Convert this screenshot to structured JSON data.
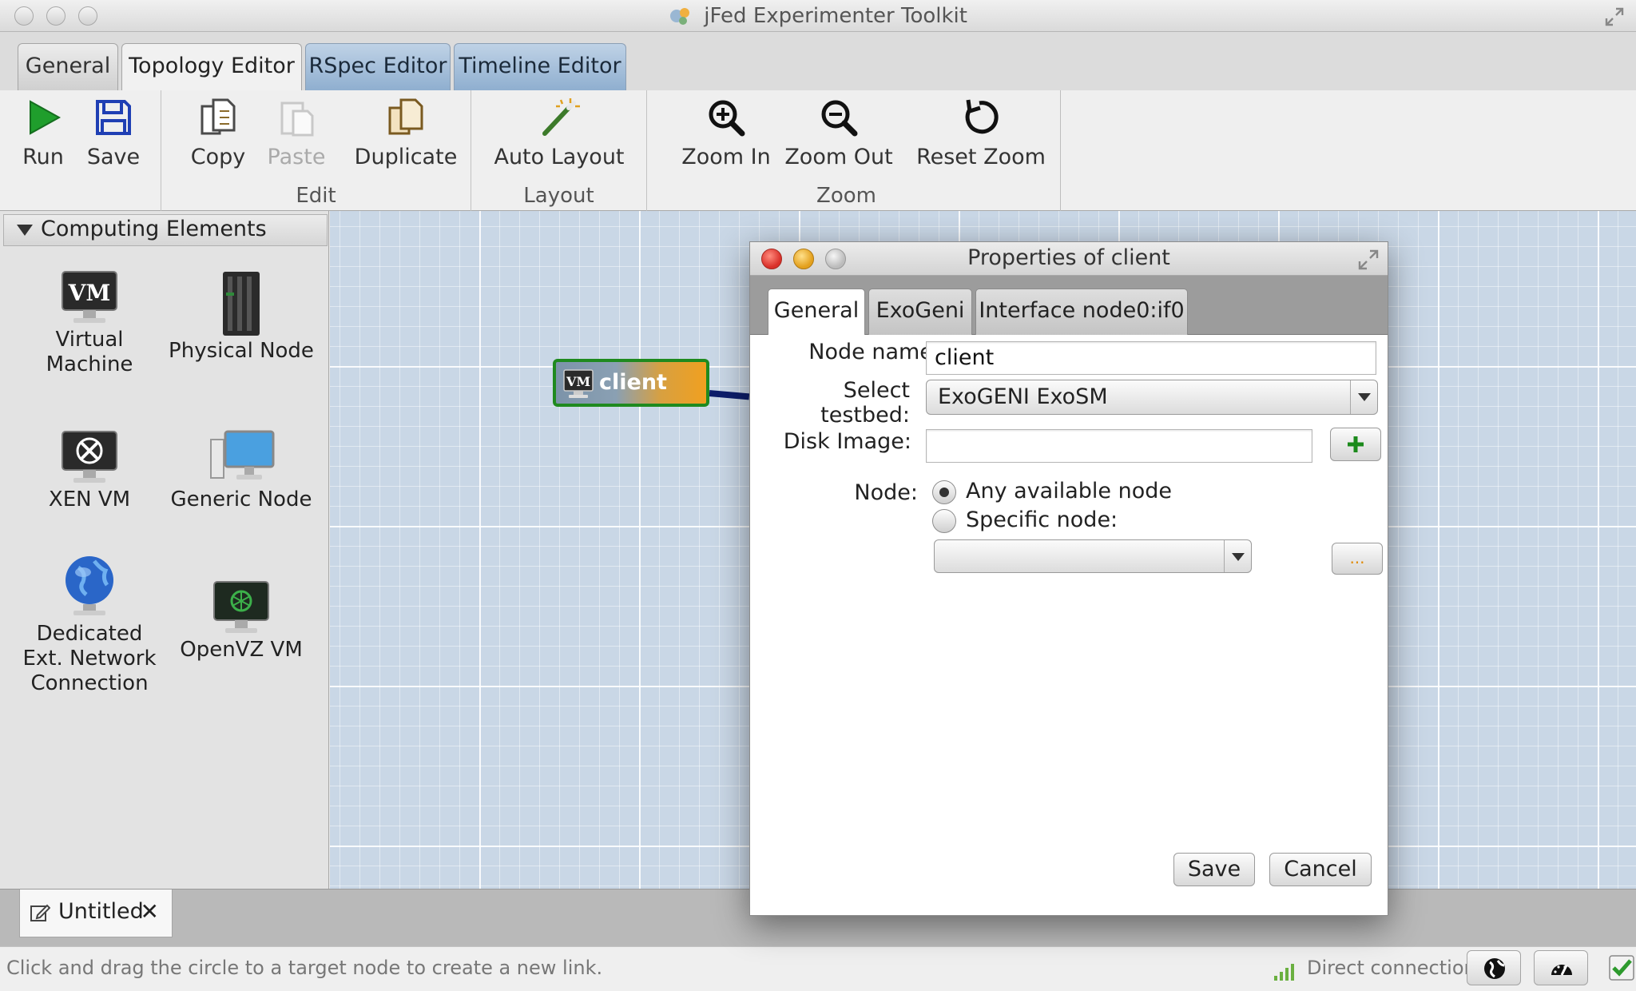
{
  "window": {
    "title": "jFed Experimenter Toolkit"
  },
  "main_tabs": [
    {
      "label": "General"
    },
    {
      "label": "Topology Editor"
    },
    {
      "label": "RSpec Editor"
    },
    {
      "label": "Timeline Editor"
    }
  ],
  "ribbon": {
    "run": "Run",
    "save": "Save",
    "copy": "Copy",
    "paste": "Paste",
    "duplicate": "Duplicate",
    "edit_group": "Edit",
    "auto_layout": "Auto Layout",
    "layout_group": "Layout",
    "zoom_in": "Zoom In",
    "zoom_out": "Zoom Out",
    "reset_zoom": "Reset Zoom",
    "zoom_group": "Zoom"
  },
  "palette": {
    "header": "Computing Elements",
    "items": [
      {
        "label_1": "Virtual",
        "label_2": "Machine",
        "icon": "vm-monitor-icon"
      },
      {
        "label_1": "Physical Node",
        "icon": "server-rack-icon"
      },
      {
        "label_1": "XEN VM",
        "icon": "xen-monitor-icon"
      },
      {
        "label_1": "Generic Node",
        "icon": "desktop-computer-icon"
      },
      {
        "label_1": "Dedicated",
        "label_2": "Ext. Network",
        "label_3": "Connection",
        "icon": "globe-icon"
      },
      {
        "label_1": "OpenVZ VM",
        "icon": "openvz-monitor-icon"
      }
    ]
  },
  "canvas": {
    "node": {
      "label": "client",
      "icon": "vm-icon"
    }
  },
  "doc_tabs": [
    {
      "label": "Untitled",
      "close": "✕"
    }
  ],
  "status": {
    "hint": "Click and drag the circle to a target node to create a new link.",
    "connection": "Direct connection"
  },
  "dialog": {
    "title": "Properties of client",
    "tabs": [
      {
        "label": "General"
      },
      {
        "label": "ExoGeni"
      },
      {
        "label": "Interface node0:if0"
      }
    ],
    "node_name_label": "Node name:",
    "node_name_value": "client",
    "testbed_label": "Select testbed:",
    "testbed_value": "ExoGENI ExoSM",
    "disk_image_label": "Disk Image:",
    "disk_image_value": "",
    "node_label": "Node:",
    "radio_any": "Any available node",
    "radio_specific": "Specific node:",
    "specific_node_value": "",
    "browse_label": "...",
    "save": "Save",
    "cancel": "Cancel"
  },
  "colors": {
    "tab_blue": "#8eaecf",
    "canvas_bg": "#c9d7e6",
    "node_border": "#1f8a1f",
    "node_orange": "#f0a020",
    "link": "#0d1e6b",
    "run_green": "#1f9e2c",
    "add_green": "#1c8a1c"
  }
}
